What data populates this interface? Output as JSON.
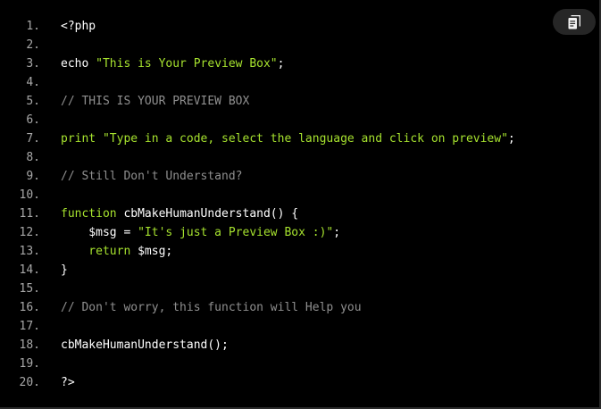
{
  "copy_button": {
    "icon": "copy-icon",
    "icon_color": "#f2f2f2",
    "background": "#262626"
  },
  "colors": {
    "background": "#000000",
    "line_number": "#a8a8a8",
    "plain": "#ffffff",
    "string": "#a6e22e",
    "comment": "#8f8f8f"
  },
  "lines": [
    {
      "number": "1.",
      "tokens": [
        {
          "type": "plain",
          "text": "<?php"
        }
      ]
    },
    {
      "number": "2.",
      "tokens": []
    },
    {
      "number": "3.",
      "tokens": [
        {
          "type": "plain",
          "text": "echo "
        },
        {
          "type": "string",
          "text": "\"This is Your Preview Box\""
        },
        {
          "type": "plain",
          "text": ";"
        }
      ]
    },
    {
      "number": "4.",
      "tokens": []
    },
    {
      "number": "5.",
      "tokens": [
        {
          "type": "comment",
          "text": "// THIS IS YOUR PREVIEW BOX"
        }
      ]
    },
    {
      "number": "6.",
      "tokens": []
    },
    {
      "number": "7.",
      "tokens": [
        {
          "type": "string",
          "text": "print \"Type in a code, select the language and click on preview\""
        },
        {
          "type": "plain",
          "text": ";"
        }
      ]
    },
    {
      "number": "8.",
      "tokens": []
    },
    {
      "number": "9.",
      "tokens": [
        {
          "type": "comment",
          "text": "// Still Don't Understand?"
        }
      ]
    },
    {
      "number": "10.",
      "tokens": []
    },
    {
      "number": "11.",
      "tokens": [
        {
          "type": "string",
          "text": "function"
        },
        {
          "type": "plain",
          "text": " cbMakeHumanUnderstand() {"
        }
      ]
    },
    {
      "number": "12.",
      "tokens": [
        {
          "type": "plain",
          "text": "    $msg = "
        },
        {
          "type": "string",
          "text": "\"It's just a Preview Box :)\""
        },
        {
          "type": "plain",
          "text": ";"
        }
      ]
    },
    {
      "number": "13.",
      "tokens": [
        {
          "type": "string",
          "text": "    return"
        },
        {
          "type": "plain",
          "text": " $msg;"
        }
      ]
    },
    {
      "number": "14.",
      "tokens": [
        {
          "type": "plain",
          "text": "}"
        }
      ]
    },
    {
      "number": "15.",
      "tokens": []
    },
    {
      "number": "16.",
      "tokens": [
        {
          "type": "comment",
          "text": "// Don't worry, this function will Help you"
        }
      ]
    },
    {
      "number": "17.",
      "tokens": []
    },
    {
      "number": "18.",
      "tokens": [
        {
          "type": "plain",
          "text": "cbMakeHumanUnderstand();"
        }
      ]
    },
    {
      "number": "19.",
      "tokens": []
    },
    {
      "number": "20.",
      "tokens": [
        {
          "type": "plain",
          "text": "?>"
        }
      ]
    }
  ]
}
